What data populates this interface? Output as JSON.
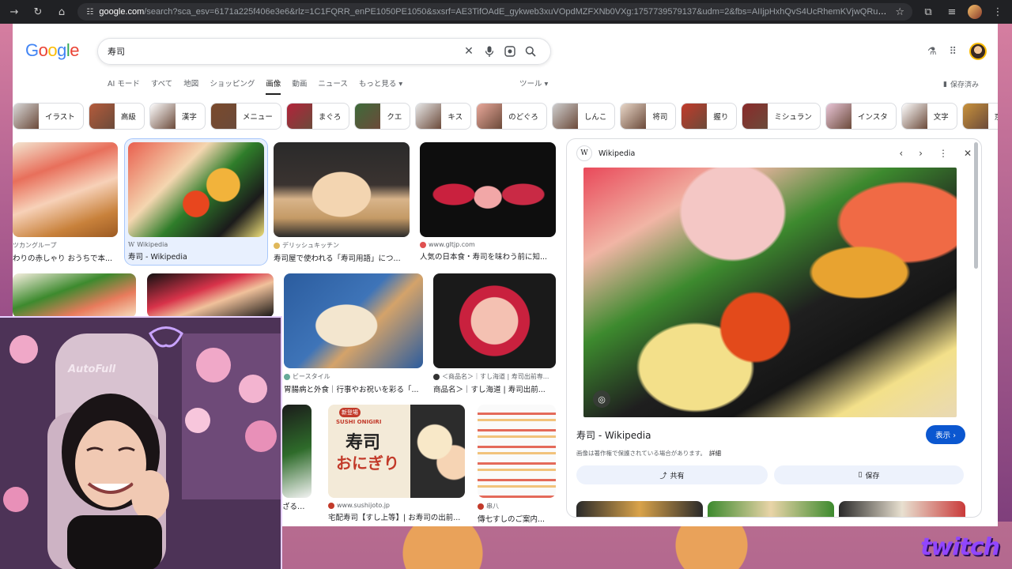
{
  "browser": {
    "url_host": "google.com",
    "url_rest": "/search?sca_esv=6171a225f406e3e6&rlz=1C1FQRR_enPE1050PE1050&sxsrf=AE3TifOAdE_gykweb3xuVOpdMZFXNb0VXg:1757739579137&udm=2&fbs=AIIjpHxhQvS4UcRhemKVjwQRu2gLZW5Nd1FHwK6o7aEa1P98HY3p31kz0lIbYr..."
  },
  "logo": "Google",
  "search": {
    "value": "寿司"
  },
  "tabs": [
    "AI モード",
    "すべて",
    "地図",
    "ショッピング",
    "画像",
    "動画",
    "ニュース",
    "もっと見る ▾"
  ],
  "tools_label": "ツール ▾",
  "saved_label": "保存済み",
  "chips": [
    "イラスト",
    "高級",
    "漢字",
    "メニュー",
    "まぐろ",
    "クエ",
    "キス",
    "のどぐろ",
    "しんこ",
    "将司",
    "握り",
    "ミシュラン",
    "インスタ",
    "文字",
    "京都"
  ],
  "results": [
    {
      "source": "ツカングループ",
      "title": "わりの赤しゃり おうちで本..."
    },
    {
      "source": "Wikipedia",
      "title": "寿司 - Wikipedia"
    },
    {
      "source": "デリッシュキッチン",
      "title": "寿司屋で使われる「寿司用語」につ..."
    },
    {
      "source": "www.gltjp.com",
      "title": "人気の日本食・寿司を味わう前に知..."
    },
    {
      "source": "ビースタイル",
      "title": "胃腸病と外食｜行事やお祝いを彩る「..."
    },
    {
      "source": "＜商品名＞｜すし海道 | 寿司出前専...",
      "title": "商品名＞｜すし海道 | 寿司出前..."
    },
    {
      "source": "",
      "title": "ざるそ..."
    },
    {
      "source": "www.sushijoto.jp",
      "title": "宅配寿司【すし上等】| お寿司の出前..."
    },
    {
      "source": "串八",
      "title": "傳七すしのご案内..."
    }
  ],
  "promo": {
    "badge": "新登場",
    "eng": "SUSHI ONIGIRI",
    "line1": "寿司",
    "line2": "おにぎり"
  },
  "panel": {
    "source": "Wikipedia",
    "title": "寿司 - Wikipedia",
    "visit": "表示 ›",
    "copyright": "画像は著作権で保護されている場合があります。",
    "details": "詳細",
    "share": "共有",
    "save": "保存"
  },
  "stream": {
    "brand": "twitch",
    "chair_logo": "AutoFull"
  }
}
